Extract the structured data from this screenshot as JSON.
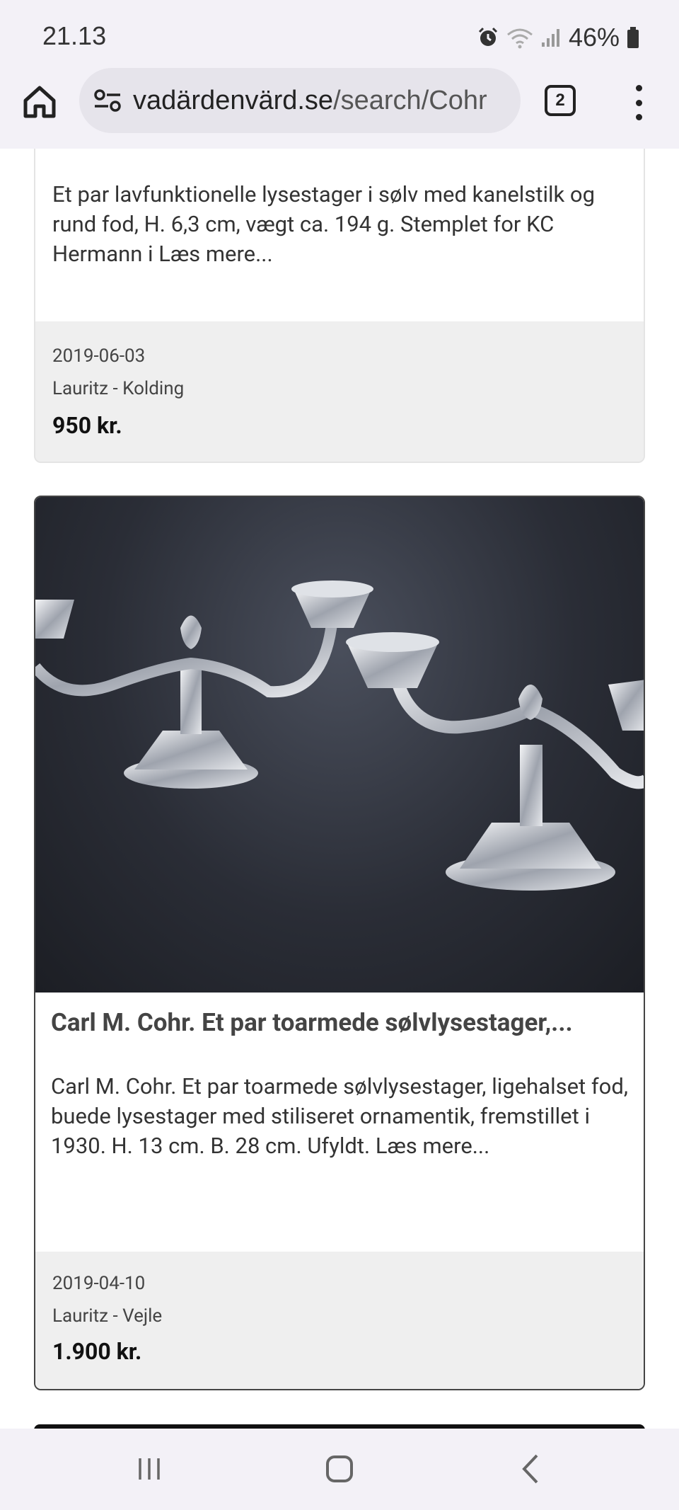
{
  "status_bar": {
    "time": "21.13",
    "battery": "46%",
    "icons": [
      "alarm-icon",
      "wifi-icon",
      "signal-icon",
      "battery-icon"
    ]
  },
  "browser": {
    "url_domain": "vadärdenvärd.se",
    "url_path": "/search/Cohr",
    "tab_count": "2",
    "icons": [
      "home-icon",
      "site-settings-icon",
      "tabs-icon",
      "more-vert-icon"
    ]
  },
  "results": [
    {
      "description": "Et par lavfunktionelle lysestager i sølv med kanelstilk og rund fod, H. 6,3 cm, vægt ca. 194 g. Stemplet for KC Hermann i Læs mere...",
      "date": "2019-06-03",
      "auction_house": "Lauritz - Kolding",
      "price": "950 kr."
    },
    {
      "title": "Carl M. Cohr. Et par toarmede sølvlysestager,...",
      "description": "Carl M. Cohr. Et par toarmede sølvlysestager, ligehalset fod, buede lysestager med stiliseret ornamentik, fremstillet i 1930. H. 13 cm. B. 28 cm. Ufyldt. Læs mere...",
      "date": "2019-04-10",
      "auction_house": "Lauritz - Vejle",
      "price": "1.900 kr.",
      "image": "two-silver-candelabras-photo"
    }
  ],
  "nav_bar": {
    "icons": [
      "recents-icon",
      "home-icon",
      "back-icon"
    ]
  }
}
